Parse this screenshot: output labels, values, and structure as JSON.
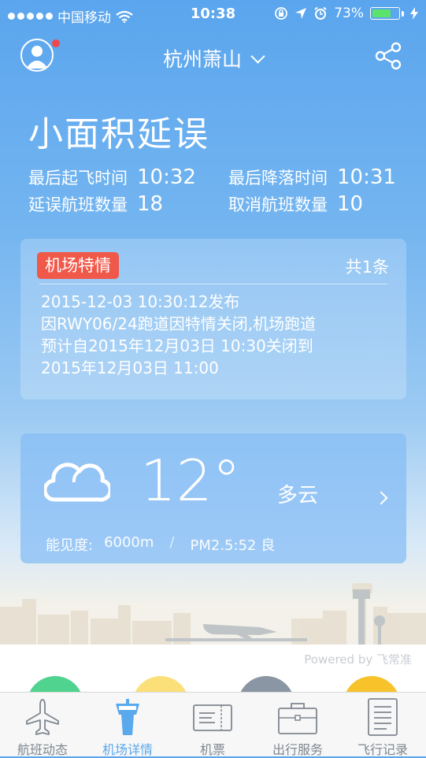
{
  "status_bar": {
    "carrier": "中国移动",
    "time": "10:38",
    "battery": "73%",
    "battery_level": 0.73
  },
  "header": {
    "location": "杭州萧山"
  },
  "airport_status": {
    "title": "小面积延误",
    "stats": [
      {
        "label": "最后起飞时间",
        "value": "10:32"
      },
      {
        "label": "最后降落时间",
        "value": "10:31"
      },
      {
        "label": "延误航班数量",
        "value": "18"
      },
      {
        "label": "取消航班数量",
        "value": "10"
      }
    ]
  },
  "notice": {
    "badge": "机场特情",
    "count": "共1条",
    "lines": [
      "2015-12-03 10:30:12发布",
      "因RWY06/24跑道因特情关闭,机场跑道",
      "预计自2015年12月03日 10:30关闭到",
      "2015年12月03日 11:00"
    ]
  },
  "weather": {
    "icon": "cloud-icon",
    "temperature": "12°",
    "condition": "多云",
    "visibility_label": "能见度:",
    "visibility": "6000m",
    "separator": "/",
    "pm25": "PM2.5:52 良"
  },
  "powered_by": "Powered by 飞常准",
  "colors": {
    "accent": "#5aa9ec",
    "badge": "#f0584a",
    "service_circles": [
      "#4fd38e",
      "#fbe07a",
      "#8a96a3",
      "#f7c22a"
    ]
  },
  "tabs": [
    {
      "label": "航班动态",
      "icon": "airplane-icon",
      "active": false
    },
    {
      "label": "机场详情",
      "icon": "tower-icon",
      "active": true
    },
    {
      "label": "机票",
      "icon": "ticket-icon",
      "active": false
    },
    {
      "label": "出行服务",
      "icon": "briefcase-icon",
      "active": false
    },
    {
      "label": "飞行记录",
      "icon": "document-icon",
      "active": false
    }
  ]
}
